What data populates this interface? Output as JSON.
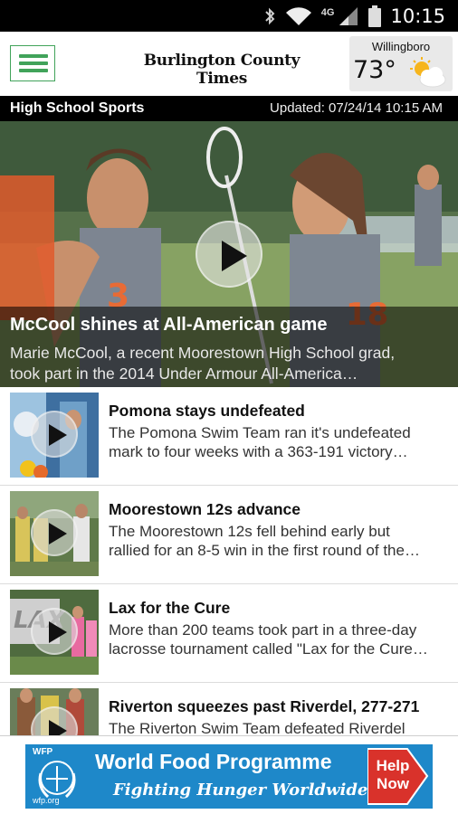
{
  "status_bar": {
    "network": "4G",
    "time": "10:15"
  },
  "header": {
    "logo_text": "Burlington County Times",
    "weather": {
      "city": "Willingboro",
      "temperature": "73°",
      "condition_icon": "partly-cloudy-icon"
    }
  },
  "section": {
    "title": "High School Sports",
    "updated": "Updated: 07/24/14 10:15 AM"
  },
  "hero": {
    "title": "McCool shines at All-American game",
    "description_line1": "Marie McCool, a recent Moorestown High School grad,",
    "description_line2": "took part in the 2014 Under Armour All-America…"
  },
  "stories": [
    {
      "title": "Pomona stays undefeated",
      "line1": "The Pomona Swim Team ran it's undefeated",
      "line2": "mark to four weeks with a 363-191 victory…"
    },
    {
      "title": "Moorestown 12s advance",
      "line1": "The Moorestown 12s fell behind early but",
      "line2": "rallied for an 8-5 win in the first round of the…"
    },
    {
      "title": "Lax for the Cure",
      "line1": "More than 200 teams took part in a three-day",
      "line2": "lacrosse tournament called \"Lax for the Cure…"
    },
    {
      "title": "Riverton squeezes past Riverdel, 277-271",
      "line1": "The Riverton Swim Team defeated Riverdel",
      "line2": ""
    }
  ],
  "ad": {
    "brand_short": "WFP",
    "title": "World Food Programme",
    "subtitle": "Fighting Hunger Worldwide",
    "cta": "Help Now",
    "url_text": "wfp.org"
  },
  "colors": {
    "accent_green": "#41a35a",
    "ad_blue": "#1e88c9",
    "ad_red": "#d9322b"
  }
}
